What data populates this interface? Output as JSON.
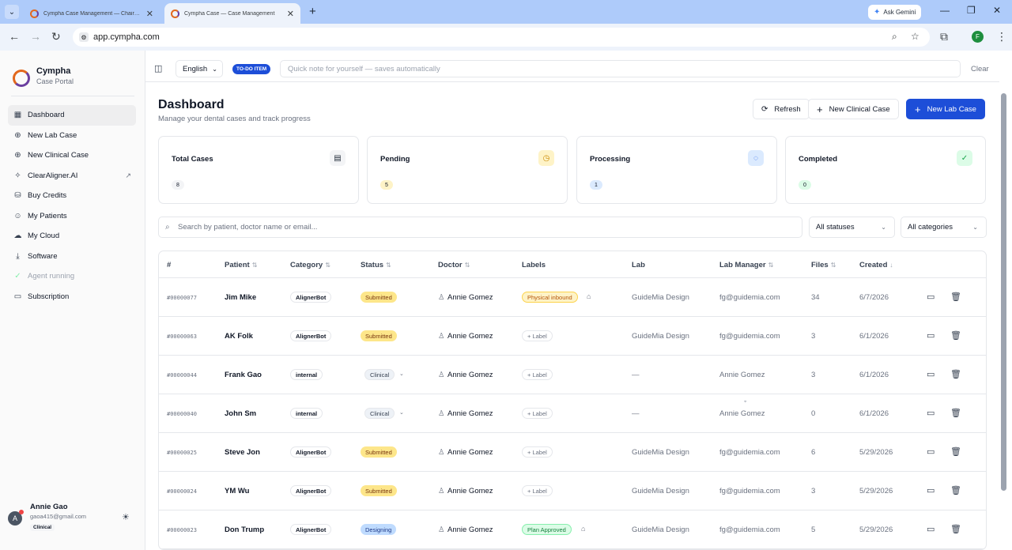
{
  "browser": {
    "tabs": [
      {
        "title": "Cympha Case Management — Chairside.consult"
      },
      {
        "title": "Cympha Case — Case Management"
      }
    ],
    "ask_gemini": "Ask Gemini",
    "url": "app.cympha.com",
    "profile_initial": "F"
  },
  "sidebar": {
    "brand_name": "Cympha",
    "brand_sub": "Case Portal",
    "items": [
      {
        "label": "Dashboard",
        "icon": "grid-icon"
      },
      {
        "label": "New Lab Case",
        "icon": "plus-circle-icon"
      },
      {
        "label": "New Clinical Case",
        "icon": "plus-circle-icon"
      },
      {
        "label": "ClearAligner.AI",
        "icon": "sparkle-icon"
      },
      {
        "label": "Buy Credits",
        "icon": "credits-icon"
      },
      {
        "label": "My Patients",
        "icon": "users-icon"
      },
      {
        "label": "My Cloud",
        "icon": "cloud-icon"
      },
      {
        "label": "Software",
        "icon": "download-icon"
      },
      {
        "label": "Agent running",
        "icon": "check-circle-icon"
      },
      {
        "label": "Subscription",
        "icon": "card-icon"
      }
    ],
    "user": {
      "initial": "A",
      "name": "Annie Gao",
      "email": "gaoa415@gmail.com",
      "role": "Clinical"
    }
  },
  "topbar": {
    "language": "English",
    "todo_badge": "TO-DO ITEM",
    "note_placeholder": "Quick note for yourself — saves automatically",
    "clear_label": "Clear"
  },
  "header": {
    "title": "Dashboard",
    "subtitle": "Manage your dental cases and track progress",
    "refresh": "Refresh",
    "new_clinical": "New Clinical Case",
    "new_lab": "New Lab Case"
  },
  "stats": [
    {
      "label": "Total Cases",
      "count": "8",
      "icon": "document-icon",
      "color": "#f3f4f6"
    },
    {
      "label": "Pending",
      "count": "5",
      "icon": "clock-icon",
      "color": "#fef3c7"
    },
    {
      "label": "Processing",
      "count": "1",
      "icon": "spinner-icon",
      "color": "#dbeafe"
    },
    {
      "label": "Completed",
      "count": "0",
      "icon": "check-circle-icon",
      "color": "#dcfce7"
    }
  ],
  "filters": {
    "search_placeholder": "Search by patient, doctor name or email...",
    "status": "All statuses",
    "category": "All categories"
  },
  "table": {
    "columns": [
      "#",
      "Patient",
      "Category",
      "Status",
      "Doctor",
      "Labels",
      "Lab",
      "Lab Manager",
      "Files",
      "Created"
    ],
    "rows": [
      {
        "id": "#00000077",
        "patient": "Jim Mike",
        "category": "AlignerBot",
        "status": "Submitted",
        "status_kind": "submitted",
        "doctor": "Annie Gomez",
        "label": "Physical inbound",
        "label_kind": "physical",
        "lab": "GuideMia Design",
        "manager": "fg@guidemia.com",
        "files": "34",
        "created": "6/7/2026"
      },
      {
        "id": "#00000063",
        "patient": "AK Folk",
        "category": "AlignerBot",
        "status": "Submitted",
        "status_kind": "submitted",
        "doctor": "Annie Gomez",
        "label": "+ Label",
        "label_kind": "label",
        "lab": "GuideMia Design",
        "manager": "fg@guidemia.com",
        "files": "3",
        "created": "6/1/2026"
      },
      {
        "id": "#00000044",
        "patient": "Frank Gao",
        "category": "internal",
        "status": "Clinical",
        "status_kind": "clinical",
        "doctor": "Annie Gomez",
        "label": "+ Label",
        "label_kind": "label",
        "lab": "—",
        "manager": "Annie Gomez",
        "files": "3",
        "created": "6/1/2026"
      },
      {
        "id": "#00000040",
        "patient": "John Sm",
        "category": "internal",
        "status": "Clinical",
        "status_kind": "clinical",
        "doctor": "Annie Gomez",
        "label": "+ Label",
        "label_kind": "label",
        "lab": "—",
        "manager": "Annie Gomez",
        "files": "0",
        "created": "6/1/2026"
      },
      {
        "id": "#00000025",
        "patient": "Steve Jon",
        "category": "AlignerBot",
        "status": "Submitted",
        "status_kind": "submitted",
        "doctor": "Annie Gomez",
        "label": "+ Label",
        "label_kind": "label",
        "lab": "GuideMia Design",
        "manager": "fg@guidemia.com",
        "files": "6",
        "created": "5/29/2026"
      },
      {
        "id": "#00000024",
        "patient": "YM Wu",
        "category": "AlignerBot",
        "status": "Submitted",
        "status_kind": "submitted",
        "doctor": "Annie Gomez",
        "label": "+ Label",
        "label_kind": "label",
        "lab": "GuideMia Design",
        "manager": "fg@guidemia.com",
        "files": "3",
        "created": "5/29/2026"
      },
      {
        "id": "#00000023",
        "patient": "Don Trump",
        "category": "AlignerBot",
        "status": "Designing",
        "status_kind": "designing",
        "doctor": "Annie Gomez",
        "label": "Plan Approved",
        "label_kind": "approved",
        "lab": "GuideMia Design",
        "manager": "fg@guidemia.com",
        "files": "5",
        "created": "5/29/2026"
      }
    ]
  }
}
